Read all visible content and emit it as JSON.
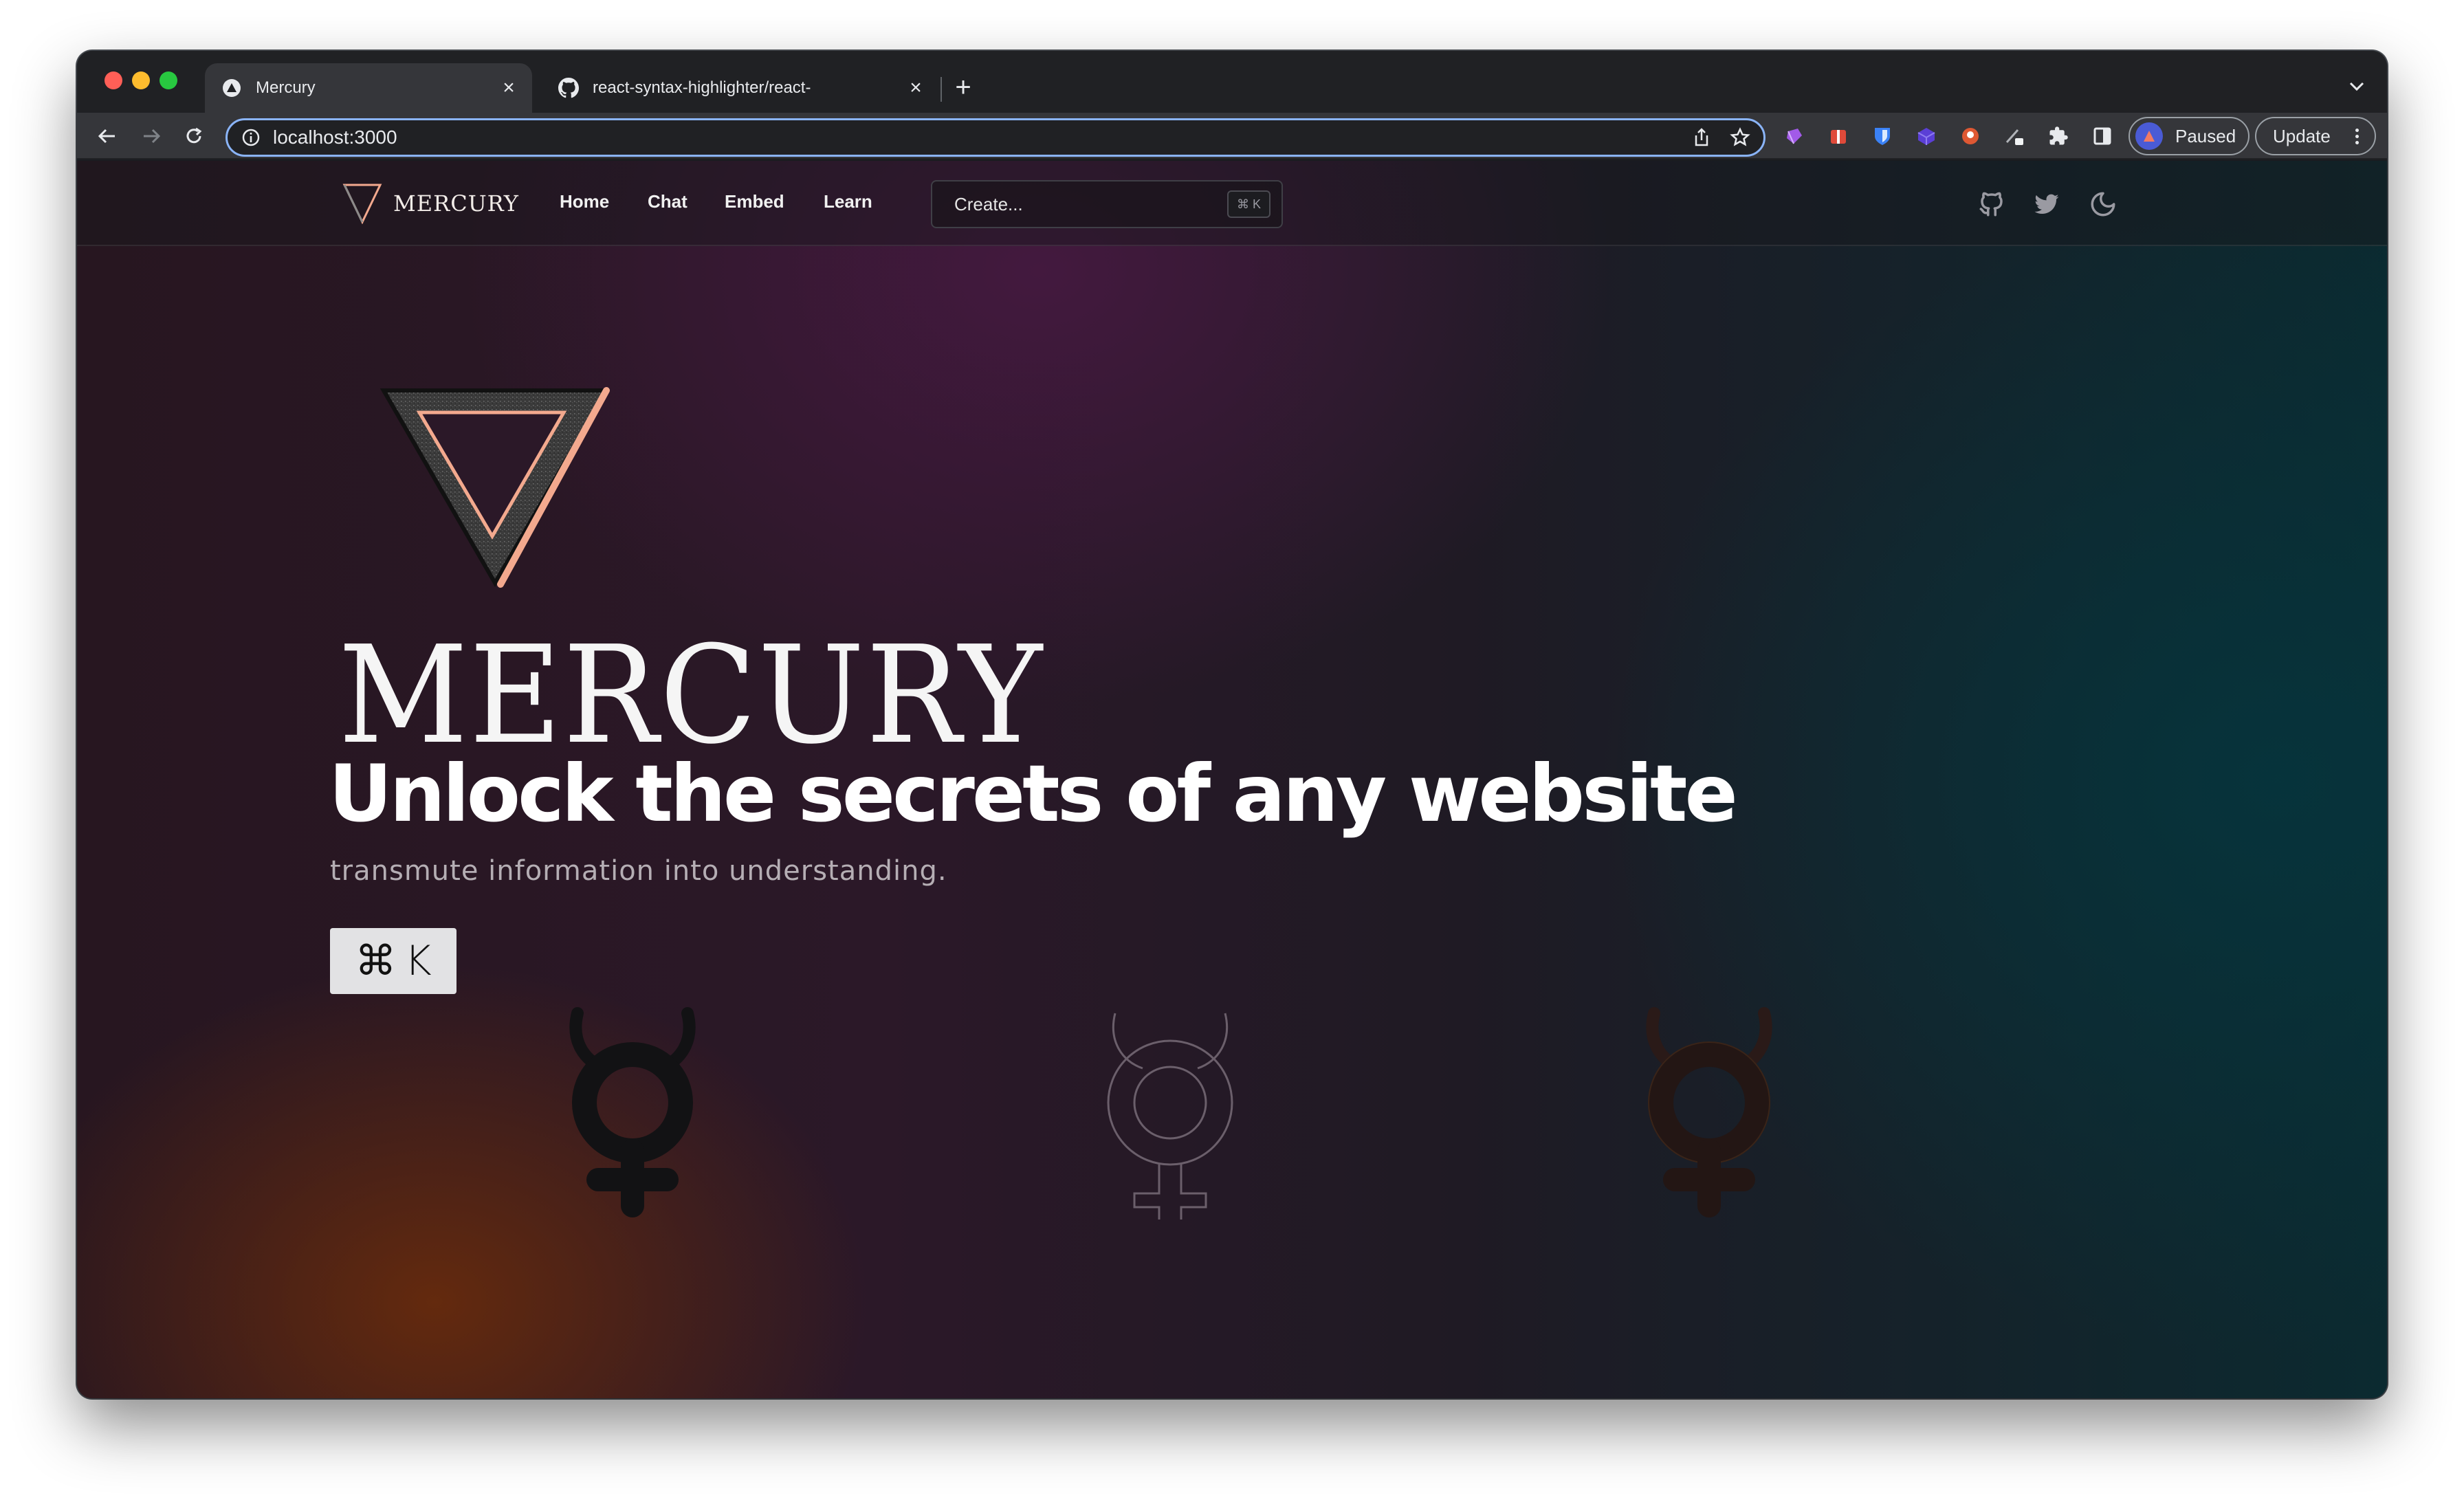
{
  "browser": {
    "tabs": [
      {
        "title": "Mercury",
        "active": true,
        "favicon": "triangle-icon"
      },
      {
        "title": "react-syntax-highlighter/react-",
        "active": false,
        "favicon": "github-icon"
      }
    ],
    "address": "localhost:3000",
    "profile_label": "Paused",
    "update_label": "Update"
  },
  "site": {
    "brand": "MERCURY",
    "nav": [
      "Home",
      "Chat",
      "Embed",
      "Learn"
    ],
    "search_placeholder": "Create...",
    "search_shortcut": "⌘ K"
  },
  "hero": {
    "wordmark": "MERCURY",
    "headline": "Unlock the secrets of any website",
    "subline": "transmute information into understanding.",
    "shortcut_symbol": "⌘",
    "shortcut_key": "K"
  },
  "colors": {
    "accent_peach": "#f3a98e",
    "omnibox_focus": "#8ab4f8",
    "headline": "#ffffff"
  }
}
